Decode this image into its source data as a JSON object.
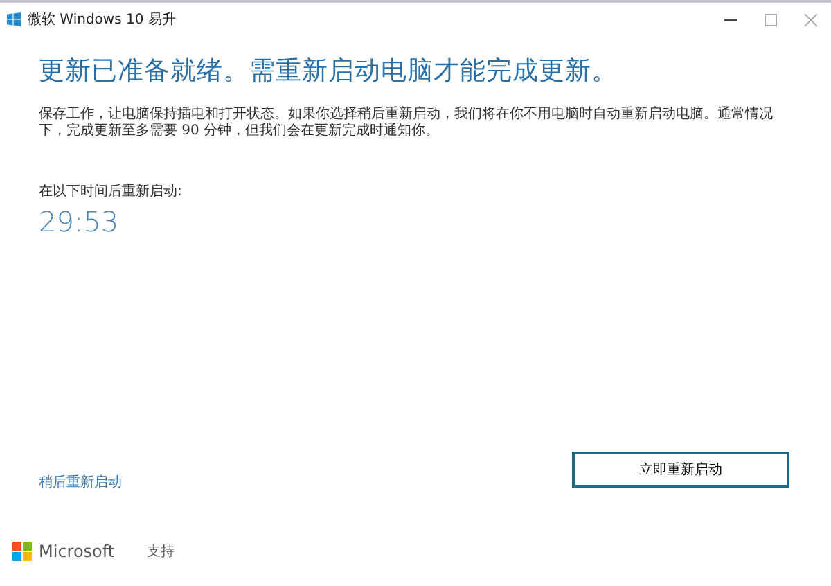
{
  "window": {
    "title": "微软 Windows 10 易升"
  },
  "heading": "更新已准备就绪。需重新启动电脑才能完成更新。",
  "message": "保存工作，让电脑保持插电和打开状态。如果你选择稍后重新启动，我们将在你不用电脑时自动重新启动电脑。通常情况下，完成更新至多需要 90 分钟，但我们会在更新完成时通知你。",
  "countdown": {
    "label": "在以下时间后重新启动:",
    "time": "29:53"
  },
  "actions": {
    "later_link": "稍后重新启动",
    "restart_button": "立即重新启动"
  },
  "footer": {
    "brand": "Microsoft",
    "support_link": "支持"
  }
}
